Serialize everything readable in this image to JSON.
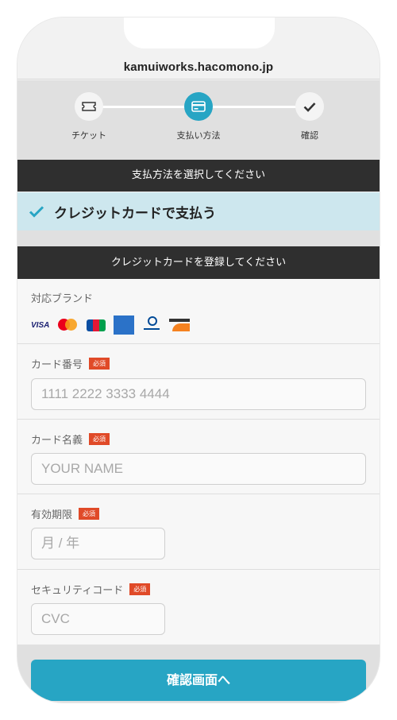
{
  "browser": {
    "url": "kamuiworks.hacomono.jp"
  },
  "stepper": {
    "steps": [
      {
        "label": "チケット",
        "state": "done",
        "icon": "ticket-icon"
      },
      {
        "label": "支払い方法",
        "state": "active",
        "icon": "credit-card-icon"
      },
      {
        "label": "確認",
        "state": "todo",
        "icon": "check-icon"
      }
    ]
  },
  "payment_method": {
    "heading": "支払方法を選択してください",
    "selected_label": "クレジットカードで支払う"
  },
  "card_form": {
    "heading": "クレジットカードを登録してください",
    "brands_label": "対応ブランド",
    "brands": [
      "VISA",
      "Mastercard",
      "JCB",
      "AMERICAN EXPRESS",
      "Diners Club",
      "DISCOVER"
    ],
    "required_badge": "必須",
    "card_number": {
      "label": "カード番号",
      "placeholder": "1111 2222 3333 4444"
    },
    "card_name": {
      "label": "カード名義",
      "placeholder": "YOUR NAME"
    },
    "expiry": {
      "label": "有効期限",
      "placeholder": "月 / 年"
    },
    "cvc": {
      "label": "セキュリティコード",
      "placeholder": "CVC"
    }
  },
  "submit_label": "確認画面へ",
  "colors": {
    "accent": "#27a5c4",
    "required": "#e04a28",
    "dark_bar": "#2f2f2f",
    "selected_bg": "#cde7ee"
  }
}
